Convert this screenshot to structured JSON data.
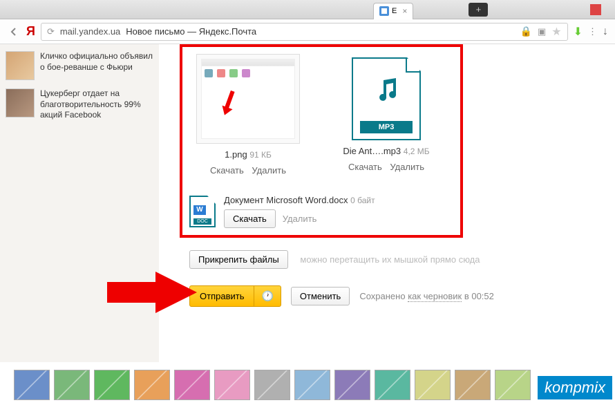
{
  "browser": {
    "url_domain": "mail.yandex.ua",
    "page_title": "Новое письмо — Яндекс.Почта",
    "tab_close": "×",
    "new_tab": "+"
  },
  "sidebar": {
    "news": [
      {
        "text": "Кличко официально объявил о бое-реванше с Фьюри"
      },
      {
        "text": "Цукерберг отдает на благотворительность 99% акций Facebook"
      }
    ]
  },
  "attachments": {
    "items": [
      {
        "name": "1.png",
        "size": "91 КБ",
        "download": "Скачать",
        "delete": "Удалить"
      },
      {
        "name": "Die Ant….mp3",
        "size": "4,2 МБ",
        "download": "Скачать",
        "delete": "Удалить",
        "mp3_label": "MP3"
      }
    ],
    "doc": {
      "name": "Документ Microsoft Word.docx",
      "size": "0 байт",
      "download": "Скачать",
      "delete": "Удалить",
      "badge": "DOC",
      "w": "W"
    }
  },
  "compose": {
    "attach_files": "Прикрепить файлы",
    "drag_hint": "можно перетащить их мышкой прямо сюда",
    "send": "Отправить",
    "cancel": "Отменить",
    "saved_prefix": "Сохранено",
    "draft_link": "как черновик",
    "saved_at": "в 00:52"
  },
  "watermark": "kompmix"
}
